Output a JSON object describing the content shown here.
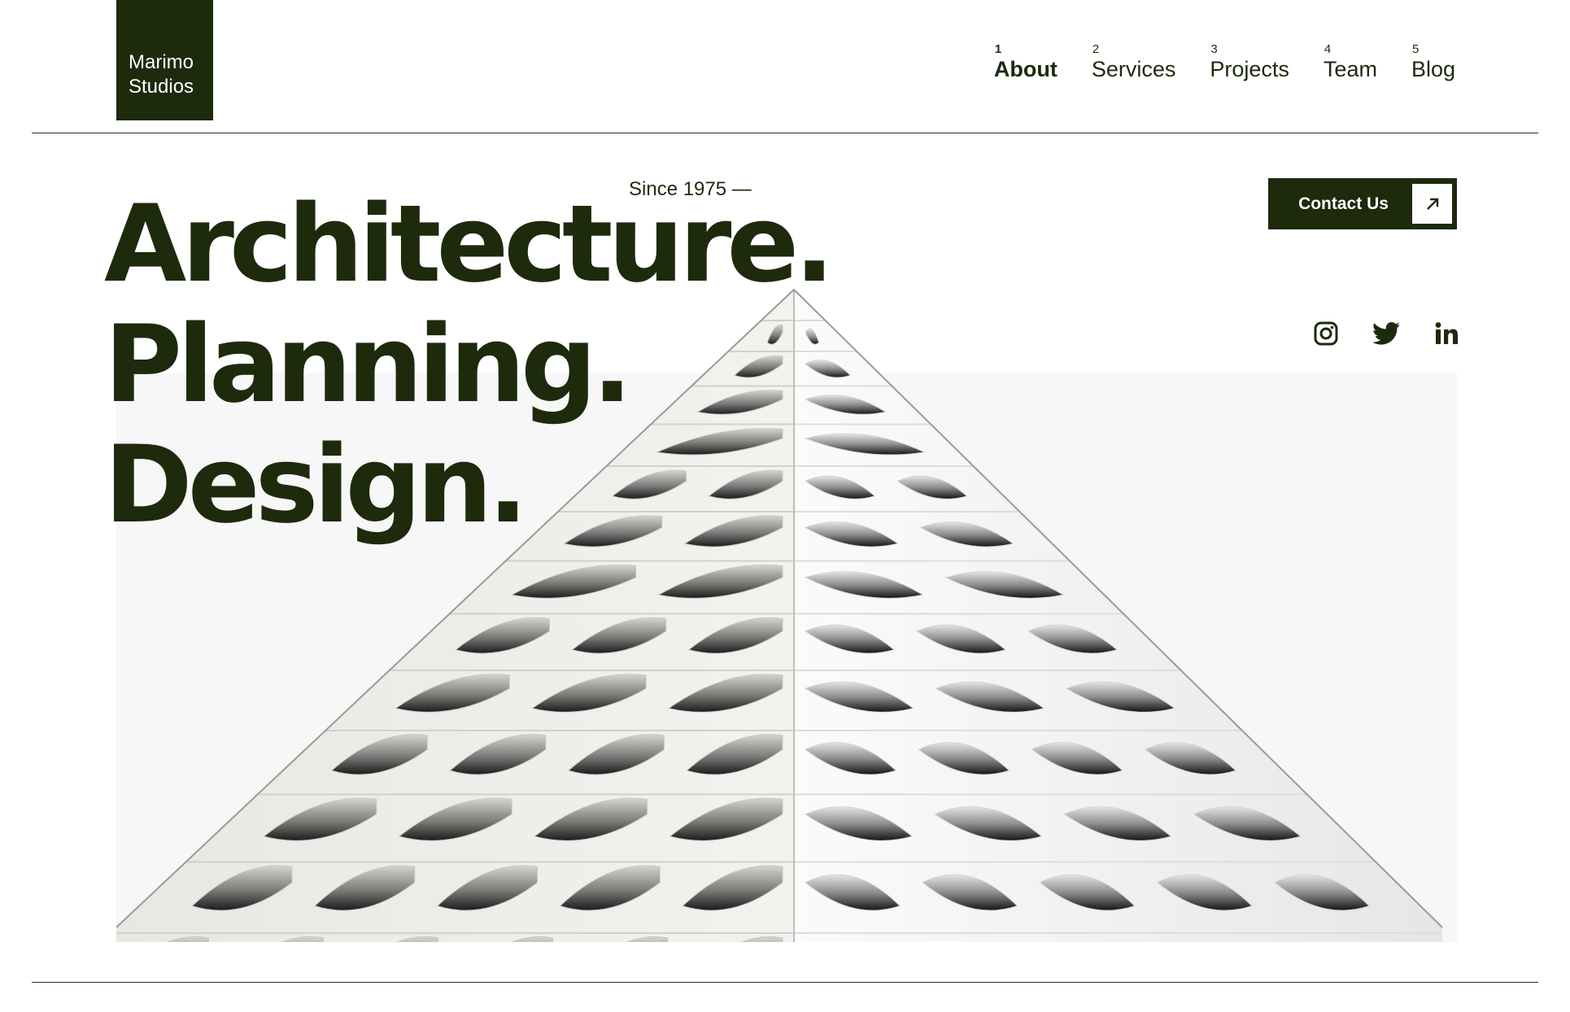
{
  "brand": {
    "line1": "Marimo",
    "line2": "Studios"
  },
  "nav": {
    "items": [
      {
        "num": "1",
        "label": "About",
        "active": true
      },
      {
        "num": "2",
        "label": "Services"
      },
      {
        "num": "3",
        "label": "Projects"
      },
      {
        "num": "4",
        "label": "Team"
      },
      {
        "num": "5",
        "label": "Blog"
      }
    ]
  },
  "hero": {
    "since": "Since 1975 —",
    "headline": [
      "Architecture.",
      "Planning.",
      "Design."
    ],
    "contact_label": "Contact Us",
    "contact_icon": "arrow-up-right-icon",
    "socials": [
      "instagram-icon",
      "twitter-icon",
      "linkedin-icon"
    ],
    "image": "building-facade-photo"
  },
  "colors": {
    "brand_dark": "#1d2a0c",
    "hero_bg": "#f7f7f7",
    "white": "#ffffff"
  }
}
